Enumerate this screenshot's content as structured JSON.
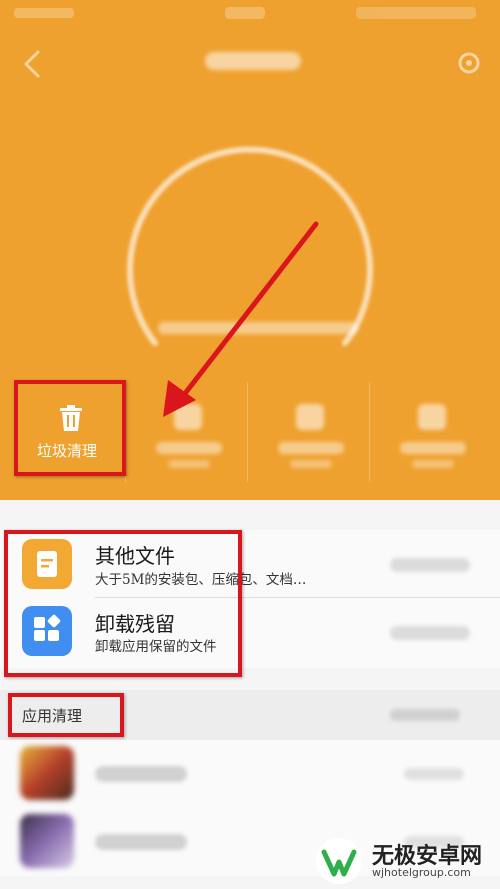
{
  "tools": {
    "junk_clean_label": "垃圾清理"
  },
  "file_rows": [
    {
      "title": "其他文件",
      "subtitle": "大于5M的安装包、压缩包、文档…",
      "icon": "document-icon",
      "color": "#f2a933"
    },
    {
      "title": "卸载残留",
      "subtitle": "卸载应用保留的文件",
      "icon": "app-grid-icon",
      "color": "#3f8ef0"
    }
  ],
  "section": {
    "app_clean_label": "应用清理"
  },
  "watermark": {
    "name": "无极安卓网",
    "url": "wjhotelgroup.com"
  },
  "colors": {
    "header_bg": "#efa12f",
    "annotation_red": "#d9161c"
  }
}
